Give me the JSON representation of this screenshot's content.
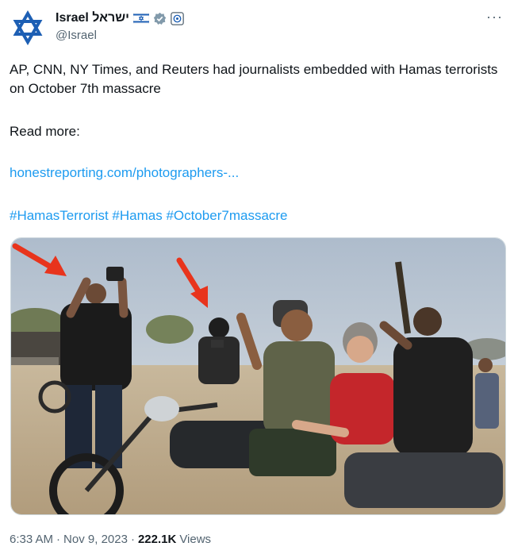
{
  "author": {
    "display_name": "Israel ישראל",
    "handle": "@Israel"
  },
  "tweet": {
    "text": "AP, CNN, NY Times, and Reuters had journalists embedded with Hamas terrorists on October 7th massacre",
    "read_more": "Read more:",
    "link": "honestreporting.com/photographers-...",
    "hashtags": "#HamasTerrorist #Hamas #October7massacre"
  },
  "meta": {
    "time": "6:33 AM",
    "separator1": "·",
    "date": "Nov 9, 2023",
    "separator2": "·",
    "views_count": "222.1K",
    "views_label": "Views"
  },
  "icons": {
    "avatar": "star-of-david-icon",
    "flag": "israel-flag-icon",
    "verified": "government-badge-icon",
    "affiliation": "affiliation-badge-icon",
    "more": "more-icon"
  },
  "colors": {
    "link": "#1d9bf0",
    "secondary_text": "#536471",
    "brand_blue": "#1d5fb4"
  }
}
